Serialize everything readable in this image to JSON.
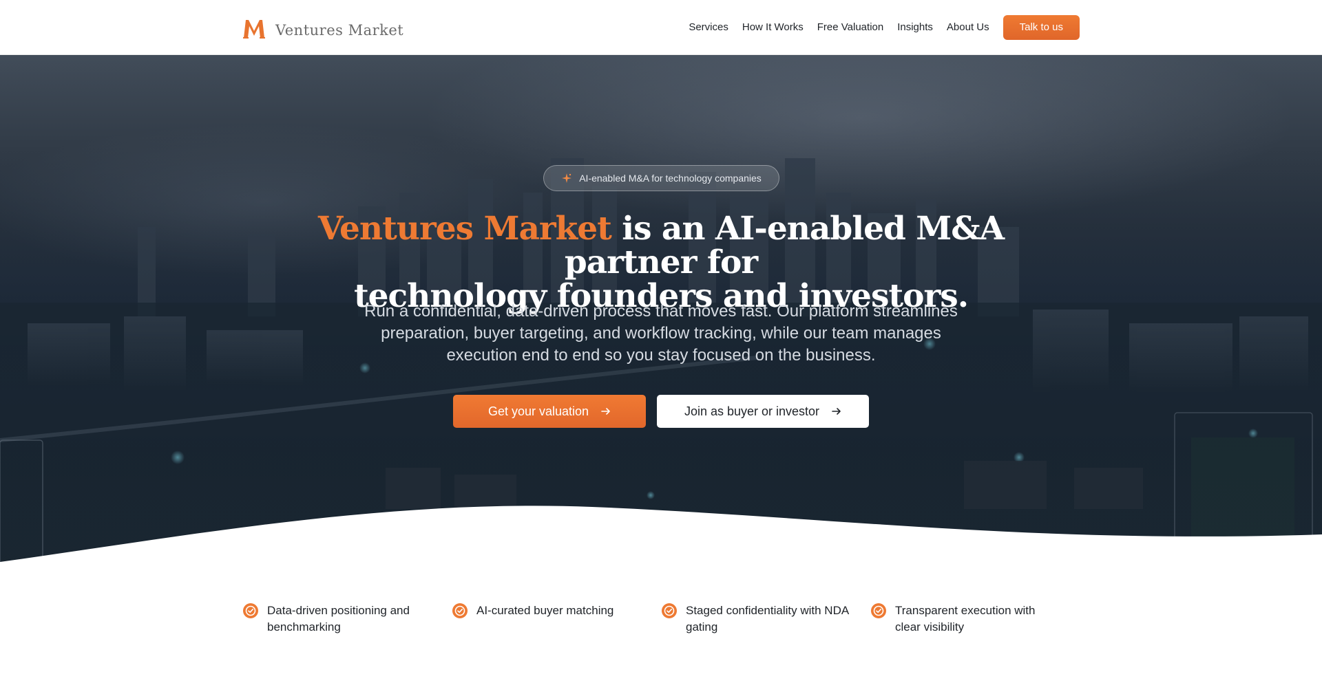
{
  "header": {
    "brand_name": "Ventures Market",
    "nav": [
      {
        "label": "Services"
      },
      {
        "label": "How It Works"
      },
      {
        "label": "Free Valuation"
      },
      {
        "label": "Insights"
      },
      {
        "label": "About Us"
      }
    ],
    "cta_label": "Talk to us"
  },
  "hero": {
    "badge_text": "AI-enabled M&A for technology companies",
    "badge_icon": "sparkle-icon",
    "headline_accent": "Ventures Market",
    "headline_line1_rest": " is an AI-enabled M&A partner for",
    "headline_line2": "technology founders and investors.",
    "subtext": "Run a confidential, data-driven process that moves fast. Our platform streamlines preparation, buyer targeting, and workflow tracking, while our team manages execution end to end so you stay focused on the business.",
    "primary_button": "Get your valuation",
    "secondary_button": "Join as buyer or investor"
  },
  "features": [
    {
      "text": "Data-driven positioning and benchmarking",
      "icon": "check-circle-icon"
    },
    {
      "text": "AI-curated buyer matching",
      "icon": "check-circle-icon"
    },
    {
      "text": "Staged confidentiality with NDA gating",
      "icon": "check-circle-icon"
    },
    {
      "text": "Transparent execution with clear visibility",
      "icon": "check-circle-icon"
    }
  ],
  "colors": {
    "accent": "#EE7A33",
    "hero_overlay": "#1C2937",
    "text_dark": "#1F2328",
    "white": "#FFFFFF"
  }
}
